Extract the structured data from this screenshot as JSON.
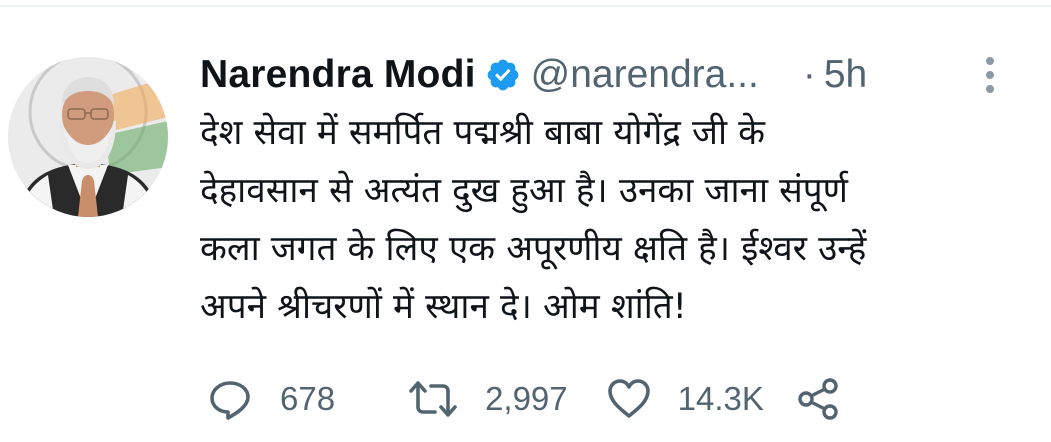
{
  "tweet": {
    "author": {
      "name": "Narendra Modi",
      "handle": "@narendra...",
      "verified": true
    },
    "separator": "·",
    "time": "5h",
    "text_lines": [
      "देश सेवा में समर्पित पद्मश्री बाबा योगेंद्र जी के",
      "देहावसान से अत्यंत दुख हुआ है। उनका जाना संपूर्ण",
      "कला जगत के लिए एक अपूरणीय क्षति है। ईश्वर उन्हें",
      "अपने श्रीचरणों में स्थान दे। ओम शांति!"
    ],
    "actions": {
      "replies": "678",
      "retweets": "2,997",
      "likes": "14.3K"
    }
  },
  "icons": {
    "verified": "verified-badge-icon",
    "more": "more-vertical-icon",
    "reply": "reply-icon",
    "retweet": "retweet-icon",
    "like": "heart-icon",
    "share": "share-icon"
  },
  "colors": {
    "verified_blue": "#1d9bf0",
    "text": "#0f1419",
    "secondary": "#536471"
  }
}
